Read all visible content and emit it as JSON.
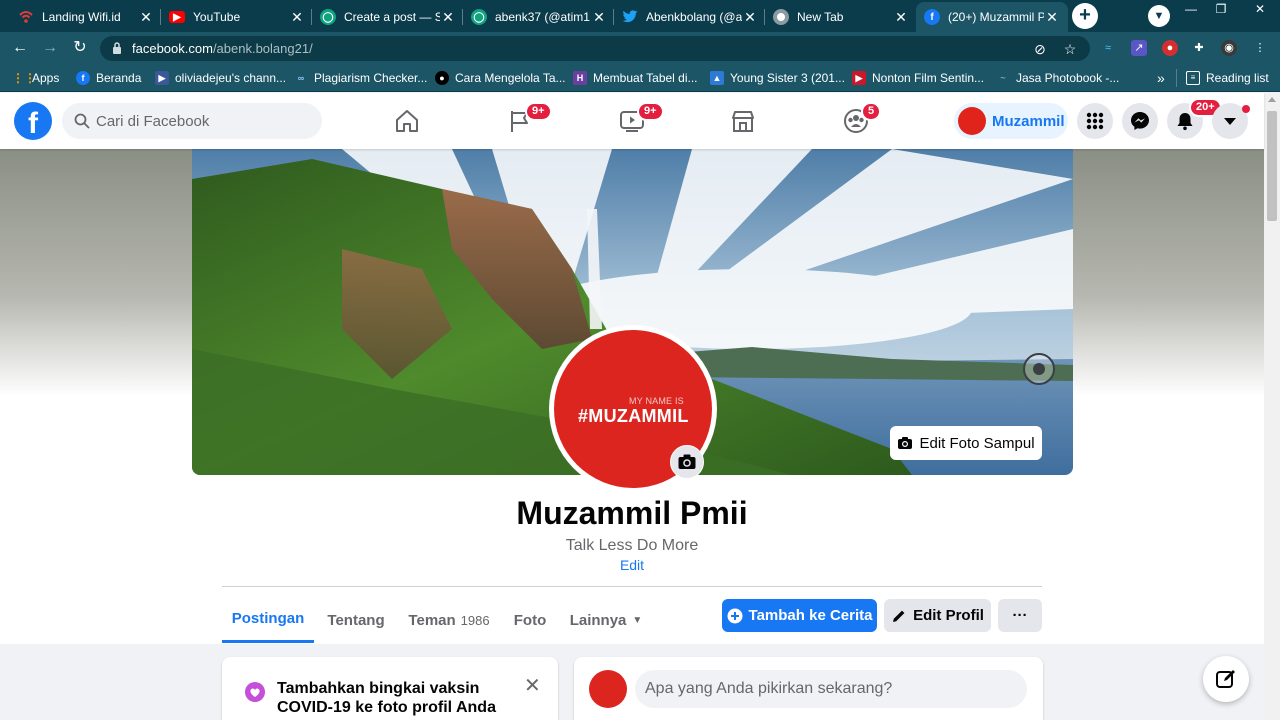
{
  "browser": {
    "tabs": [
      {
        "title": "Landing Wifi.id",
        "icon": "wifi-icon",
        "color": "#cc1f1f"
      },
      {
        "title": "YouTube",
        "icon": "youtube-icon",
        "color": "#ff0000"
      },
      {
        "title": "Create a post — S",
        "icon": "chat-icon",
        "color": "#10a37f"
      },
      {
        "title": "abenk37 (@atim1",
        "icon": "chat-icon",
        "color": "#10a37f"
      },
      {
        "title": "Abenkbolang (@a",
        "icon": "twitter-icon",
        "color": "#1da1f2"
      },
      {
        "title": "New Tab",
        "icon": "chrome-icon",
        "color": "#5f6368"
      },
      {
        "title": "(20+) Muzammil P",
        "icon": "facebook-icon",
        "color": "#1877f2"
      }
    ],
    "url_host": "facebook.com",
    "url_path": "/abenk.bolang21/",
    "bookmarks": [
      {
        "label": "Apps",
        "icon": "apps-grid-icon",
        "color": "#ff6d00"
      },
      {
        "label": "Beranda",
        "icon": "facebook-icon",
        "color": "#1877f2"
      },
      {
        "label": "oliviadejeu's chann...",
        "icon": "video-icon",
        "color": "#3b5998"
      },
      {
        "label": "Plagiarism Checker...",
        "icon": "link-icon",
        "color": "#4a90d9"
      },
      {
        "label": "Cara Mengelola Ta...",
        "icon": "medium-icon",
        "color": "#000000"
      },
      {
        "label": "Membuat Tabel di...",
        "icon": "h-icon",
        "color": "#6b3fa0"
      },
      {
        "label": "Young Sister 3 (201...",
        "icon": "image-icon",
        "color": "#2e7bd6"
      },
      {
        "label": "Nonton Film Sentin...",
        "icon": "film-icon",
        "color": "#c9182b"
      },
      {
        "label": "Jasa Photobook -...",
        "icon": "photo-icon",
        "color": "#8aa3aa"
      }
    ],
    "reading_list": "Reading list",
    "more_bookmarks": "»"
  },
  "facebook": {
    "search_placeholder": "Cari di Facebook",
    "badges": {
      "pages": "9+",
      "watch": "9+",
      "groups": "5",
      "notifications": "20+"
    },
    "account_name": "Muzammil",
    "colors": {
      "brand": "#1877f2",
      "badge": "#e41e3f",
      "avatar": "#dd2520"
    }
  },
  "profile": {
    "name": "Muzammil Pmii",
    "bio": "Talk Less Do More",
    "edit_bio": "Edit",
    "avatar_small_text": "MY NAME IS",
    "avatar_big_text": "#MUZAMMIL",
    "edit_cover": "Edit Foto Sampul",
    "tabs": [
      {
        "label": "Postingan",
        "count": ""
      },
      {
        "label": "Tentang",
        "count": ""
      },
      {
        "label": "Teman",
        "count": "1986"
      },
      {
        "label": "Foto",
        "count": ""
      },
      {
        "label": "Lainnya",
        "count": ""
      }
    ],
    "add_story": "Tambah ke Cerita",
    "edit_profile": "Edit Profil",
    "more": "···",
    "vaccine_prompt": "Tambahkan bingkai vaksin COVID-19 ke foto profil Anda",
    "composer_placeholder": "Apa yang Anda pikirkan sekarang?"
  }
}
